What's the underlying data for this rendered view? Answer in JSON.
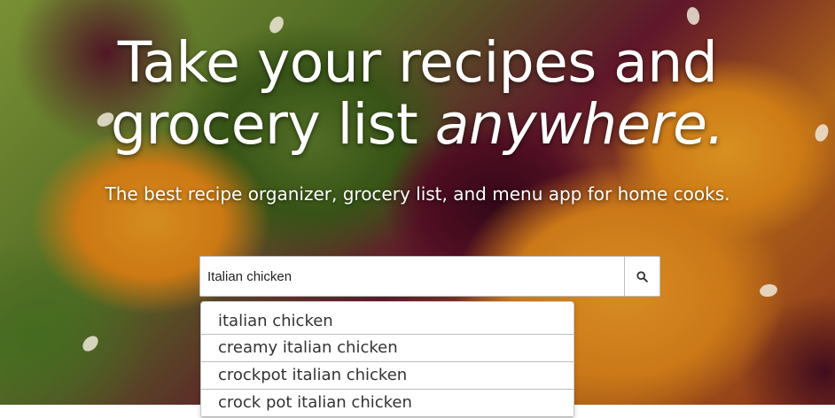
{
  "hero": {
    "headline_line1": "Take your recipes and",
    "headline_line2_plain": "grocery list ",
    "headline_line2_emphasis": "anywhere.",
    "subtitle": "The best recipe organizer, grocery list, and menu app for home cooks."
  },
  "search": {
    "value": "Italian chicken",
    "button_icon": "search-icon"
  },
  "suggestions": [
    "italian chicken",
    "creamy italian chicken",
    "crockpot italian chicken",
    "crock pot italian chicken"
  ],
  "colors": {
    "headline_text": "#ffffff",
    "input_border": "#bdbdbd",
    "suggestion_text": "#333333"
  }
}
